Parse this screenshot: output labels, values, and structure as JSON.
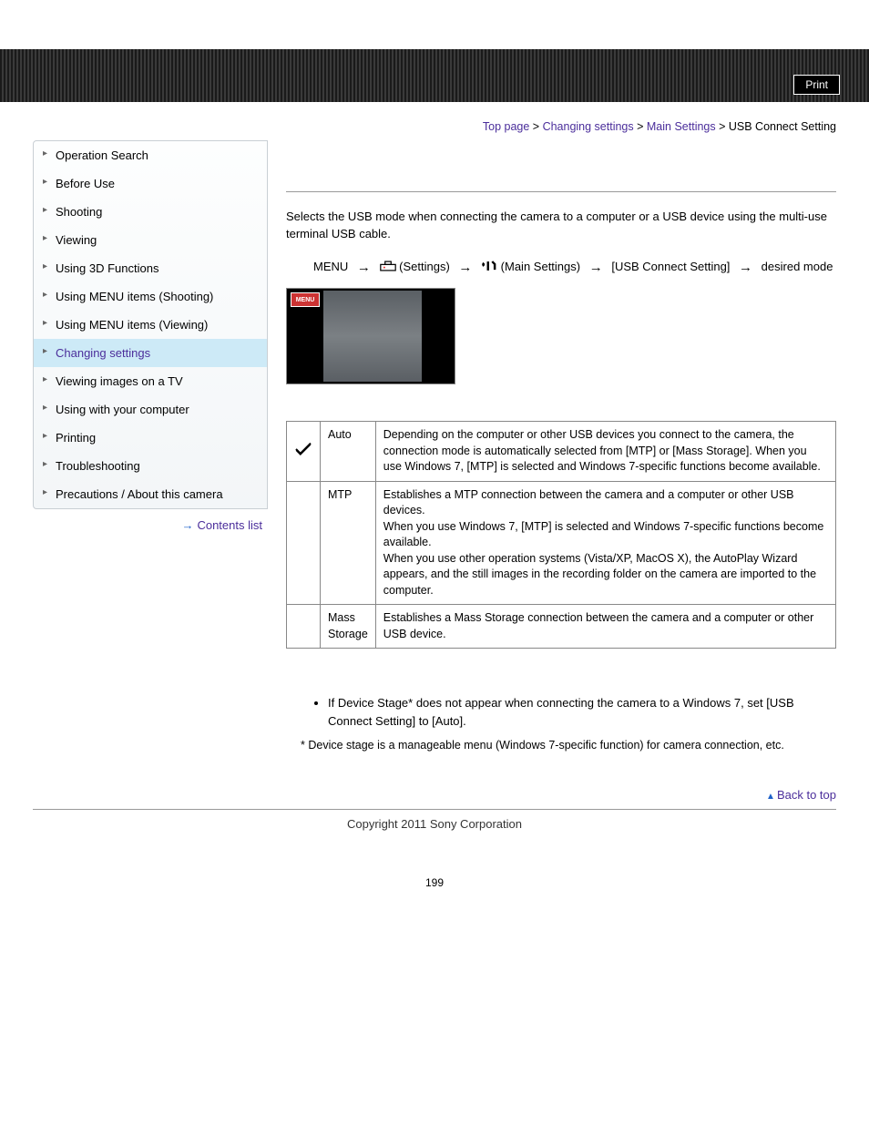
{
  "header": {
    "print_label": "Print"
  },
  "breadcrumb": {
    "top_page": "Top page",
    "changing_settings": "Changing settings",
    "main_settings": "Main Settings",
    "current": "USB Connect Setting",
    "sep": " > "
  },
  "sidebar": {
    "items": [
      "Operation Search",
      "Before Use",
      "Shooting",
      "Viewing",
      "Using 3D Functions",
      "Using MENU items (Shooting)",
      "Using MENU items (Viewing)",
      "Changing settings",
      "Viewing images on a TV",
      "Using with your computer",
      "Printing",
      "Troubleshooting",
      "Precautions / About this camera"
    ],
    "active_index": 7,
    "contents_list": "Contents list"
  },
  "main": {
    "intro": "Selects the USB mode when connecting the camera to a computer or a USB device using the multi-use terminal USB cable.",
    "menu_path": {
      "menu": "MENU",
      "settings": "(Settings)",
      "main_settings": "(Main Settings)",
      "usb_setting": "[USB Connect Setting]",
      "desired": "desired mode"
    },
    "screenshot_tag": "MENU",
    "table": {
      "rows": [
        {
          "checked": true,
          "label": "Auto",
          "desc": "Depending on the computer or other USB devices you connect to the camera, the connection mode is automatically selected from [MTP] or [Mass Storage]. When you use Windows 7, [MTP] is selected and Windows 7-specific functions become available."
        },
        {
          "checked": false,
          "label": "MTP",
          "desc": "Establishes a MTP connection between the camera and a computer or other USB devices.\nWhen you use Windows 7, [MTP] is selected and Windows 7-specific functions become available.\nWhen you use other operation systems (Vista/XP, MacOS X), the AutoPlay Wizard appears, and the still images in the recording folder on the camera are imported to the computer."
        },
        {
          "checked": false,
          "label": "Mass Storage",
          "desc": "Establishes a Mass Storage connection between the camera and a computer or other USB device."
        }
      ]
    },
    "note": "If Device Stage* does not appear when connecting the camera to a Windows 7, set [USB Connect Setting] to [Auto].",
    "footnote": "* Device stage is a manageable menu (Windows 7-specific function) for camera connection, etc."
  },
  "footer": {
    "back_to_top": "Back to top",
    "copyright": "Copyright 2011 Sony Corporation",
    "page_number": "199"
  }
}
